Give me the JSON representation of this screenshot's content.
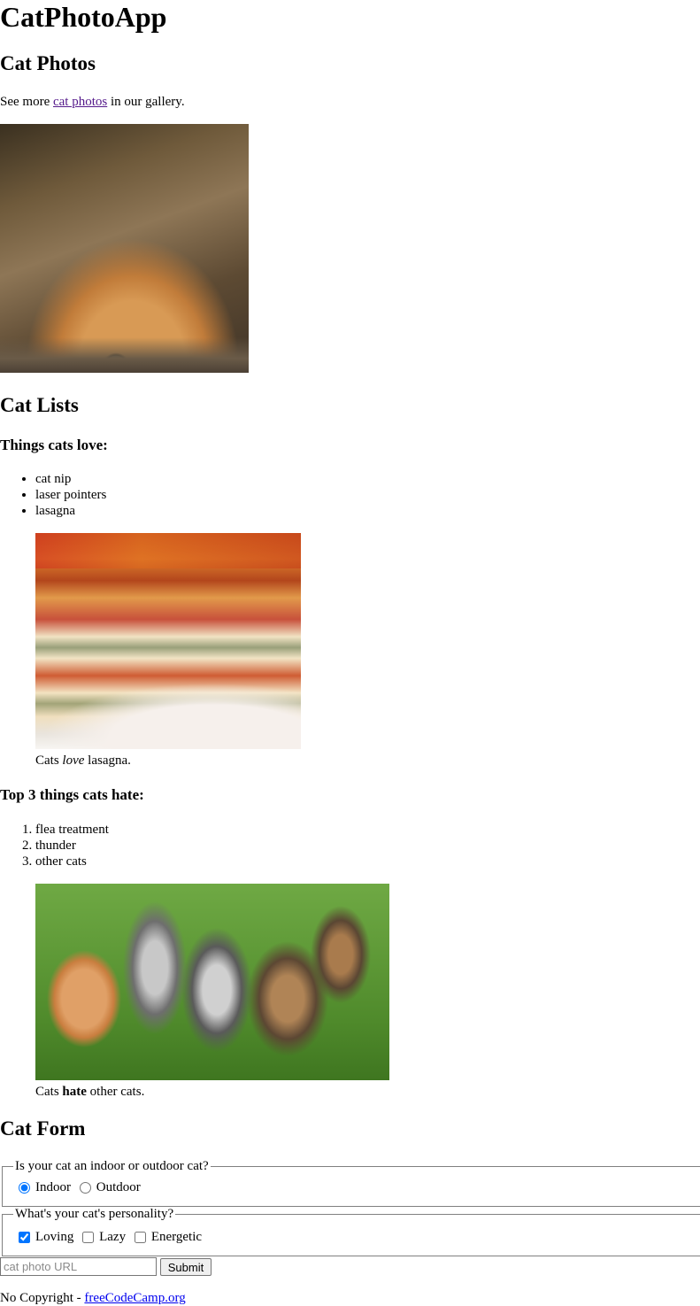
{
  "app_title": "CatPhotoApp",
  "photos": {
    "heading": "Cat Photos",
    "lead_text_before": "See more",
    "lead_link": "cat photos",
    "lead_text_after": "in our gallery."
  },
  "lists": {
    "heading": "Cat Lists",
    "love_heading": "Things cats love:",
    "love_items": [
      "cat nip",
      "laser pointers",
      "lasagna"
    ],
    "love_caption_before": "Cats",
    "love_caption_emph": "love",
    "love_caption_after": "lasagna.",
    "hate_heading": "Top 3 things cats hate:",
    "hate_items": [
      "flea treatment",
      "thunder",
      "other cats"
    ],
    "hate_caption_before": "Cats",
    "hate_caption_strong": "hate",
    "hate_caption_after": "other cats."
  },
  "form": {
    "heading": "Cat Form",
    "indoor_legend": "Is your cat an indoor or outdoor cat?",
    "indoor_label": "Indoor",
    "outdoor_label": "Outdoor",
    "indoor_checked": true,
    "personality_legend": "What's your cat's personality?",
    "loving_label": "Loving",
    "lazy_label": "Lazy",
    "energetic_label": "Energetic",
    "loving_checked": true,
    "url_placeholder": "cat photo URL",
    "submit_label": "Submit"
  },
  "footer": {
    "text": "No Copyright -",
    "link": "freeCodeCamp.org"
  }
}
